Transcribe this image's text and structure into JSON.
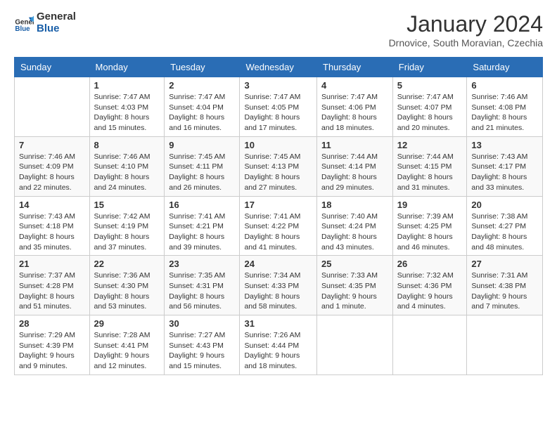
{
  "logo": {
    "line1": "General",
    "line2": "Blue"
  },
  "title": "January 2024",
  "location": "Drnovice, South Moravian, Czechia",
  "days_of_week": [
    "Sunday",
    "Monday",
    "Tuesday",
    "Wednesday",
    "Thursday",
    "Friday",
    "Saturday"
  ],
  "weeks": [
    [
      {
        "day": null
      },
      {
        "day": "1",
        "sunrise": "7:47 AM",
        "sunset": "4:03 PM",
        "daylight": "8 hours and 15 minutes."
      },
      {
        "day": "2",
        "sunrise": "7:47 AM",
        "sunset": "4:04 PM",
        "daylight": "8 hours and 16 minutes."
      },
      {
        "day": "3",
        "sunrise": "7:47 AM",
        "sunset": "4:05 PM",
        "daylight": "8 hours and 17 minutes."
      },
      {
        "day": "4",
        "sunrise": "7:47 AM",
        "sunset": "4:06 PM",
        "daylight": "8 hours and 18 minutes."
      },
      {
        "day": "5",
        "sunrise": "7:47 AM",
        "sunset": "4:07 PM",
        "daylight": "8 hours and 20 minutes."
      },
      {
        "day": "6",
        "sunrise": "7:46 AM",
        "sunset": "4:08 PM",
        "daylight": "8 hours and 21 minutes."
      }
    ],
    [
      {
        "day": "7",
        "sunrise": "7:46 AM",
        "sunset": "4:09 PM",
        "daylight": "8 hours and 22 minutes."
      },
      {
        "day": "8",
        "sunrise": "7:46 AM",
        "sunset": "4:10 PM",
        "daylight": "8 hours and 24 minutes."
      },
      {
        "day": "9",
        "sunrise": "7:45 AM",
        "sunset": "4:11 PM",
        "daylight": "8 hours and 26 minutes."
      },
      {
        "day": "10",
        "sunrise": "7:45 AM",
        "sunset": "4:13 PM",
        "daylight": "8 hours and 27 minutes."
      },
      {
        "day": "11",
        "sunrise": "7:44 AM",
        "sunset": "4:14 PM",
        "daylight": "8 hours and 29 minutes."
      },
      {
        "day": "12",
        "sunrise": "7:44 AM",
        "sunset": "4:15 PM",
        "daylight": "8 hours and 31 minutes."
      },
      {
        "day": "13",
        "sunrise": "7:43 AM",
        "sunset": "4:17 PM",
        "daylight": "8 hours and 33 minutes."
      }
    ],
    [
      {
        "day": "14",
        "sunrise": "7:43 AM",
        "sunset": "4:18 PM",
        "daylight": "8 hours and 35 minutes."
      },
      {
        "day": "15",
        "sunrise": "7:42 AM",
        "sunset": "4:19 PM",
        "daylight": "8 hours and 37 minutes."
      },
      {
        "day": "16",
        "sunrise": "7:41 AM",
        "sunset": "4:21 PM",
        "daylight": "8 hours and 39 minutes."
      },
      {
        "day": "17",
        "sunrise": "7:41 AM",
        "sunset": "4:22 PM",
        "daylight": "8 hours and 41 minutes."
      },
      {
        "day": "18",
        "sunrise": "7:40 AM",
        "sunset": "4:24 PM",
        "daylight": "8 hours and 43 minutes."
      },
      {
        "day": "19",
        "sunrise": "7:39 AM",
        "sunset": "4:25 PM",
        "daylight": "8 hours and 46 minutes."
      },
      {
        "day": "20",
        "sunrise": "7:38 AM",
        "sunset": "4:27 PM",
        "daylight": "8 hours and 48 minutes."
      }
    ],
    [
      {
        "day": "21",
        "sunrise": "7:37 AM",
        "sunset": "4:28 PM",
        "daylight": "8 hours and 51 minutes."
      },
      {
        "day": "22",
        "sunrise": "7:36 AM",
        "sunset": "4:30 PM",
        "daylight": "8 hours and 53 minutes."
      },
      {
        "day": "23",
        "sunrise": "7:35 AM",
        "sunset": "4:31 PM",
        "daylight": "8 hours and 56 minutes."
      },
      {
        "day": "24",
        "sunrise": "7:34 AM",
        "sunset": "4:33 PM",
        "daylight": "8 hours and 58 minutes."
      },
      {
        "day": "25",
        "sunrise": "7:33 AM",
        "sunset": "4:35 PM",
        "daylight": "9 hours and 1 minute."
      },
      {
        "day": "26",
        "sunrise": "7:32 AM",
        "sunset": "4:36 PM",
        "daylight": "9 hours and 4 minutes."
      },
      {
        "day": "27",
        "sunrise": "7:31 AM",
        "sunset": "4:38 PM",
        "daylight": "9 hours and 7 minutes."
      }
    ],
    [
      {
        "day": "28",
        "sunrise": "7:29 AM",
        "sunset": "4:39 PM",
        "daylight": "9 hours and 9 minutes."
      },
      {
        "day": "29",
        "sunrise": "7:28 AM",
        "sunset": "4:41 PM",
        "daylight": "9 hours and 12 minutes."
      },
      {
        "day": "30",
        "sunrise": "7:27 AM",
        "sunset": "4:43 PM",
        "daylight": "9 hours and 15 minutes."
      },
      {
        "day": "31",
        "sunrise": "7:26 AM",
        "sunset": "4:44 PM",
        "daylight": "9 hours and 18 minutes."
      },
      {
        "day": null
      },
      {
        "day": null
      },
      {
        "day": null
      }
    ]
  ],
  "labels": {
    "sunrise": "Sunrise:",
    "sunset": "Sunset:",
    "daylight": "Daylight:"
  }
}
